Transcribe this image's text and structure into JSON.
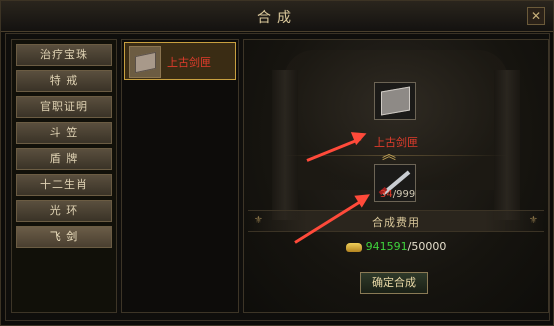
{
  "window": {
    "title": "合成",
    "close_icon": "close-icon"
  },
  "sidebar": {
    "items": [
      {
        "label": "治疗宝珠"
      },
      {
        "label": "特  戒"
      },
      {
        "label": "官职证明"
      },
      {
        "label": "斗  笠"
      },
      {
        "label": "盾  牌"
      },
      {
        "label": "十二生肖"
      },
      {
        "label": "光  环"
      },
      {
        "label": "飞  剑"
      }
    ]
  },
  "recipes": [
    {
      "label": "上古剑匣",
      "icon": "sword-case-icon",
      "selected": true
    }
  ],
  "synthesis": {
    "result": {
      "label": "上古剑匣",
      "icon": "sword-case-icon"
    },
    "material": {
      "have": "34",
      "need": "/999",
      "icon": "sword-icon"
    },
    "cost_title": "合成费用",
    "gold": {
      "have": "941591",
      "need": "/50000",
      "icon": "gold-ingot-icon"
    },
    "confirm_label": "确定合成"
  },
  "colors": {
    "required_red": "#e03c2c",
    "gold_green": "#3fd23c",
    "annotation_red": "#ff4a3a"
  }
}
